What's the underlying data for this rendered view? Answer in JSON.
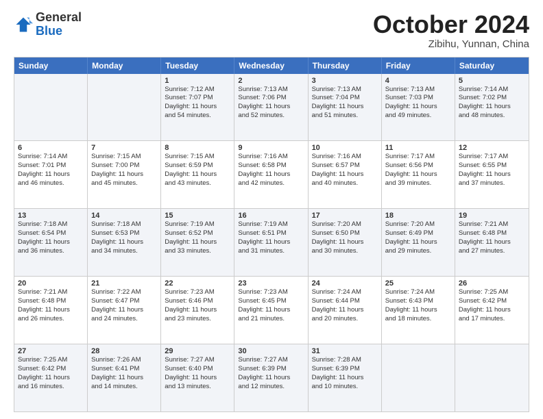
{
  "header": {
    "logo": {
      "general": "General",
      "blue": "Blue"
    },
    "title": "October 2024",
    "location": "Zibihu, Yunnan, China"
  },
  "days_of_week": [
    "Sunday",
    "Monday",
    "Tuesday",
    "Wednesday",
    "Thursday",
    "Friday",
    "Saturday"
  ],
  "weeks": [
    [
      {
        "day": "",
        "lines": []
      },
      {
        "day": "",
        "lines": []
      },
      {
        "day": "1",
        "lines": [
          "Sunrise: 7:12 AM",
          "Sunset: 7:07 PM",
          "Daylight: 11 hours",
          "and 54 minutes."
        ]
      },
      {
        "day": "2",
        "lines": [
          "Sunrise: 7:13 AM",
          "Sunset: 7:06 PM",
          "Daylight: 11 hours",
          "and 52 minutes."
        ]
      },
      {
        "day": "3",
        "lines": [
          "Sunrise: 7:13 AM",
          "Sunset: 7:04 PM",
          "Daylight: 11 hours",
          "and 51 minutes."
        ]
      },
      {
        "day": "4",
        "lines": [
          "Sunrise: 7:13 AM",
          "Sunset: 7:03 PM",
          "Daylight: 11 hours",
          "and 49 minutes."
        ]
      },
      {
        "day": "5",
        "lines": [
          "Sunrise: 7:14 AM",
          "Sunset: 7:02 PM",
          "Daylight: 11 hours",
          "and 48 minutes."
        ]
      }
    ],
    [
      {
        "day": "6",
        "lines": [
          "Sunrise: 7:14 AM",
          "Sunset: 7:01 PM",
          "Daylight: 11 hours",
          "and 46 minutes."
        ]
      },
      {
        "day": "7",
        "lines": [
          "Sunrise: 7:15 AM",
          "Sunset: 7:00 PM",
          "Daylight: 11 hours",
          "and 45 minutes."
        ]
      },
      {
        "day": "8",
        "lines": [
          "Sunrise: 7:15 AM",
          "Sunset: 6:59 PM",
          "Daylight: 11 hours",
          "and 43 minutes."
        ]
      },
      {
        "day": "9",
        "lines": [
          "Sunrise: 7:16 AM",
          "Sunset: 6:58 PM",
          "Daylight: 11 hours",
          "and 42 minutes."
        ]
      },
      {
        "day": "10",
        "lines": [
          "Sunrise: 7:16 AM",
          "Sunset: 6:57 PM",
          "Daylight: 11 hours",
          "and 40 minutes."
        ]
      },
      {
        "day": "11",
        "lines": [
          "Sunrise: 7:17 AM",
          "Sunset: 6:56 PM",
          "Daylight: 11 hours",
          "and 39 minutes."
        ]
      },
      {
        "day": "12",
        "lines": [
          "Sunrise: 7:17 AM",
          "Sunset: 6:55 PM",
          "Daylight: 11 hours",
          "and 37 minutes."
        ]
      }
    ],
    [
      {
        "day": "13",
        "lines": [
          "Sunrise: 7:18 AM",
          "Sunset: 6:54 PM",
          "Daylight: 11 hours",
          "and 36 minutes."
        ]
      },
      {
        "day": "14",
        "lines": [
          "Sunrise: 7:18 AM",
          "Sunset: 6:53 PM",
          "Daylight: 11 hours",
          "and 34 minutes."
        ]
      },
      {
        "day": "15",
        "lines": [
          "Sunrise: 7:19 AM",
          "Sunset: 6:52 PM",
          "Daylight: 11 hours",
          "and 33 minutes."
        ]
      },
      {
        "day": "16",
        "lines": [
          "Sunrise: 7:19 AM",
          "Sunset: 6:51 PM",
          "Daylight: 11 hours",
          "and 31 minutes."
        ]
      },
      {
        "day": "17",
        "lines": [
          "Sunrise: 7:20 AM",
          "Sunset: 6:50 PM",
          "Daylight: 11 hours",
          "and 30 minutes."
        ]
      },
      {
        "day": "18",
        "lines": [
          "Sunrise: 7:20 AM",
          "Sunset: 6:49 PM",
          "Daylight: 11 hours",
          "and 29 minutes."
        ]
      },
      {
        "day": "19",
        "lines": [
          "Sunrise: 7:21 AM",
          "Sunset: 6:48 PM",
          "Daylight: 11 hours",
          "and 27 minutes."
        ]
      }
    ],
    [
      {
        "day": "20",
        "lines": [
          "Sunrise: 7:21 AM",
          "Sunset: 6:48 PM",
          "Daylight: 11 hours",
          "and 26 minutes."
        ]
      },
      {
        "day": "21",
        "lines": [
          "Sunrise: 7:22 AM",
          "Sunset: 6:47 PM",
          "Daylight: 11 hours",
          "and 24 minutes."
        ]
      },
      {
        "day": "22",
        "lines": [
          "Sunrise: 7:23 AM",
          "Sunset: 6:46 PM",
          "Daylight: 11 hours",
          "and 23 minutes."
        ]
      },
      {
        "day": "23",
        "lines": [
          "Sunrise: 7:23 AM",
          "Sunset: 6:45 PM",
          "Daylight: 11 hours",
          "and 21 minutes."
        ]
      },
      {
        "day": "24",
        "lines": [
          "Sunrise: 7:24 AM",
          "Sunset: 6:44 PM",
          "Daylight: 11 hours",
          "and 20 minutes."
        ]
      },
      {
        "day": "25",
        "lines": [
          "Sunrise: 7:24 AM",
          "Sunset: 6:43 PM",
          "Daylight: 11 hours",
          "and 18 minutes."
        ]
      },
      {
        "day": "26",
        "lines": [
          "Sunrise: 7:25 AM",
          "Sunset: 6:42 PM",
          "Daylight: 11 hours",
          "and 17 minutes."
        ]
      }
    ],
    [
      {
        "day": "27",
        "lines": [
          "Sunrise: 7:25 AM",
          "Sunset: 6:42 PM",
          "Daylight: 11 hours",
          "and 16 minutes."
        ]
      },
      {
        "day": "28",
        "lines": [
          "Sunrise: 7:26 AM",
          "Sunset: 6:41 PM",
          "Daylight: 11 hours",
          "and 14 minutes."
        ]
      },
      {
        "day": "29",
        "lines": [
          "Sunrise: 7:27 AM",
          "Sunset: 6:40 PM",
          "Daylight: 11 hours",
          "and 13 minutes."
        ]
      },
      {
        "day": "30",
        "lines": [
          "Sunrise: 7:27 AM",
          "Sunset: 6:39 PM",
          "Daylight: 11 hours",
          "and 12 minutes."
        ]
      },
      {
        "day": "31",
        "lines": [
          "Sunrise: 7:28 AM",
          "Sunset: 6:39 PM",
          "Daylight: 11 hours",
          "and 10 minutes."
        ]
      },
      {
        "day": "",
        "lines": []
      },
      {
        "day": "",
        "lines": []
      }
    ]
  ],
  "alt_rows": [
    0,
    2,
    4
  ]
}
